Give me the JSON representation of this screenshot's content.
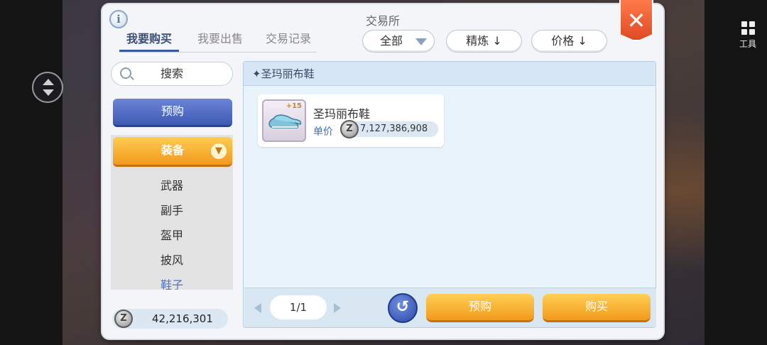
{
  "dialog": {
    "title": "交易所"
  },
  "tabs": [
    {
      "label": "我要购买",
      "active": true
    },
    {
      "label": "我要出售",
      "active": false
    },
    {
      "label": "交易记录",
      "active": false
    }
  ],
  "filters": {
    "all": "全部",
    "refine_sort": "精炼 ↓",
    "price_sort": "价格 ↓"
  },
  "search": {
    "label": "搜索"
  },
  "sidebar": {
    "preorder": "预购",
    "category": "装备",
    "subcategories": [
      "武器",
      "副手",
      "盔甲",
      "披风",
      "鞋子"
    ],
    "selected_subcategory": "鞋子"
  },
  "balance": {
    "amount": "42,216,301"
  },
  "content": {
    "header": "✦圣玛丽布鞋",
    "item": {
      "name": "圣玛丽布鞋",
      "refine": "+15",
      "unit_label": "单价",
      "price": "7,127,386,908"
    }
  },
  "pager": {
    "page": "1/1"
  },
  "actions": {
    "preorder": "预购",
    "buy": "购买"
  },
  "toolbar": {
    "tools": "工具"
  },
  "icons": {
    "close": "close-icon",
    "info": "info-icon",
    "search": "search-icon",
    "zeny": "zeny-coin-icon",
    "refresh": "refresh-icon",
    "tools": "grid-icon"
  },
  "colors": {
    "accent_blue": "#3d5ab4",
    "accent_orange": "#f09a1c",
    "close_red": "#e04a24"
  }
}
